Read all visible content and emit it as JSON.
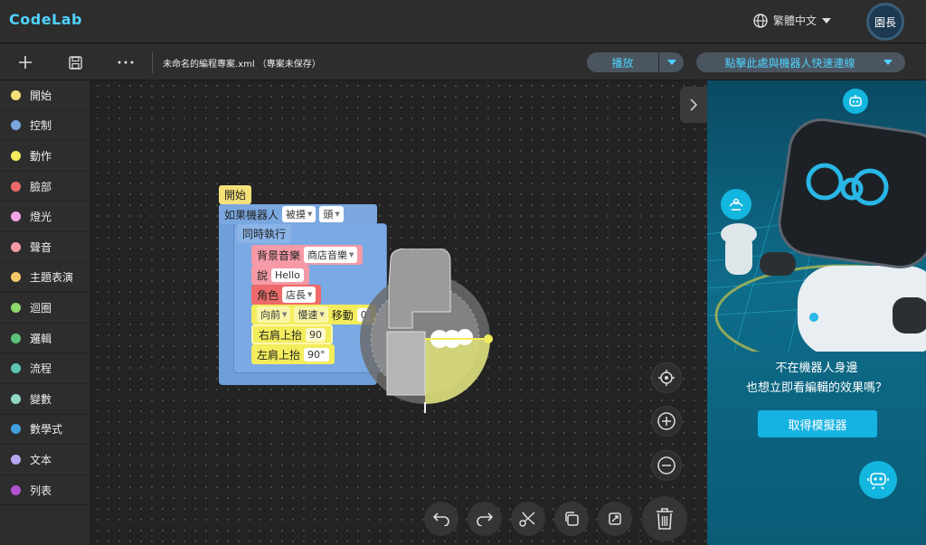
{
  "app": {
    "logo": "CodeLab",
    "language": "繁體中文",
    "avatar_label": "園長"
  },
  "toolbar": {
    "filename": "未命名的編程專案.xml （專案未保存）",
    "play_label": "播放",
    "connect_label": "點擊此處與機器人快速連線"
  },
  "sidebar": {
    "items": [
      {
        "label": "開始",
        "color": "#f6e07a"
      },
      {
        "label": "控制",
        "color": "#7aa7e0"
      },
      {
        "label": "動作",
        "color": "#f3ec5c"
      },
      {
        "label": "臉部",
        "color": "#ee6a6a"
      },
      {
        "label": "燈光",
        "color": "#f4a3e6"
      },
      {
        "label": "聲音",
        "color": "#f59aa6"
      },
      {
        "label": "主題表演",
        "color": "#f7c86a"
      },
      {
        "label": "迴圈",
        "color": "#8fd86a"
      },
      {
        "label": "邏輯",
        "color": "#5cc27c"
      },
      {
        "label": "流程",
        "color": "#5bc7b0"
      },
      {
        "label": "變數",
        "color": "#8fd7c6"
      },
      {
        "label": "數學式",
        "color": "#3fa0e0"
      },
      {
        "label": "文本",
        "color": "#b7a6f0"
      },
      {
        "label": "列表",
        "color": "#b253d0"
      }
    ]
  },
  "blocks": {
    "start": "開始",
    "if_robot": "如果機器人",
    "touched": "被摸",
    "head": "頭",
    "parallel": "同時執行",
    "bgm": "背景音樂",
    "bgm_value": "商店音樂",
    "say": "說",
    "say_value": "Hello",
    "role": "角色",
    "role_value": "店長",
    "forward": "向前",
    "speed": "慢速",
    "move": "移動",
    "move_value": "0",
    "right_shoulder": "右肩上抬",
    "right_value": "90",
    "left_shoulder": "左肩上抬",
    "left_value": "90°"
  },
  "simulator": {
    "line1": "不在機器人身邊",
    "line2": "也想立即看編輯的效果嗎？",
    "button": "取得模擬器"
  }
}
